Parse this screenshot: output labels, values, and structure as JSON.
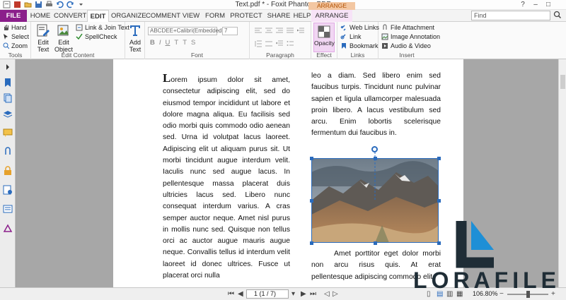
{
  "window": {
    "title": "Text.pdf * - Foxit PhantomPDF",
    "controls": [
      "–",
      "□",
      "✕"
    ]
  },
  "quick_access_icons": [
    "file-icon",
    "pdf-icon",
    "open-icon",
    "save-icon",
    "print-icon",
    "undo-icon",
    "redo-icon",
    "dropdown-icon"
  ],
  "tabs": {
    "file": "FILE",
    "home": "HOME",
    "convert": "CONVERT",
    "edit": "EDIT",
    "organize": "ORGANIZE",
    "comment": "COMMENT",
    "view": "VIEW",
    "form": "FORM",
    "protect": "PROTECT",
    "share": "SHARE",
    "help": "HELP",
    "arrange": "ARRANGE",
    "context_header": "ARRANGE"
  },
  "find": {
    "placeholder": "Find"
  },
  "ribbon": {
    "tools": {
      "hand": "Hand",
      "select": "Select",
      "zoom": "Zoom",
      "label": "Tools"
    },
    "edit_content": {
      "edit_text": "Edit Text",
      "edit_text_l1": "Edit",
      "edit_text_l2": "Text",
      "edit_object_l1": "Edit",
      "edit_object_l2": "Object",
      "link_join": "Link & Join Text",
      "spellcheck": "SpellCheck",
      "label": "Edit Content"
    },
    "add_text": {
      "l1": "Add",
      "l2": "Text"
    },
    "font": {
      "family": "ABCDEE+Calibri(Embedded)",
      "size": "7",
      "format_buttons": [
        "B",
        "I",
        "U",
        "T",
        "T",
        "S"
      ],
      "label": "Font"
    },
    "paragraph": {
      "label": "Paragraph"
    },
    "effect": {
      "opacity": "Opacity",
      "label": "Effect"
    },
    "links": {
      "web_links": "Web Links",
      "link": "Link",
      "bookmark": "Bookmark",
      "label": "Links"
    },
    "insert": {
      "file_attachment": "File Attachment",
      "image_annotation": "Image Annotation",
      "audio_video": "Audio & Video",
      "label": "Insert"
    }
  },
  "document": {
    "left_dropcap": "L",
    "left_text": "orem ipsum dolor sit amet, consectetur adipiscing elit, sed do eiusmod tempor incididunt ut labore et dolore magna aliqua. Eu facilisis sed odio morbi quis commodo odio aenean sed. Urna id volutpat lacus laoreet. Adipiscing elit ut aliquam purus sit. Ut morbi tincidunt augue interdum velit. Iaculis nunc sed augue lacus. In pellentesque massa placerat duis ultricies lacus sed. Libero nunc consequat interdum varius. A cras semper auctor neque. Amet nisl purus in mollis nunc sed. Quisque non tellus orci ac auctor augue mauris augue neque. Convallis tellus id interdum velit laoreet id donec ultrices. Fusce ut placerat orci nulla",
    "right_top_text": "leo a diam. Sed libero enim sed faucibus turpis. Tincidunt nunc pulvinar sapien et ligula ullamcorper malesuada proin libero. A lacus vestibulum sed arcu. Enim lobortis scelerisque fermentum dui faucibus in.",
    "right_bottom_text": "Amet porttitor eget dolor morbi non arcu risus quis. At erat pellentesque adipiscing commodo elit"
  },
  "statusbar": {
    "page_display": "1 (1 / 7)",
    "zoom": "106.80%"
  },
  "watermark": {
    "text": "LORAFILE"
  },
  "colors": {
    "file_tab": "#8b1f8b",
    "selection": "#2a6bbd",
    "opacity_highlight": "#f1d6f3",
    "arrange_header": "#f3c7a2"
  }
}
